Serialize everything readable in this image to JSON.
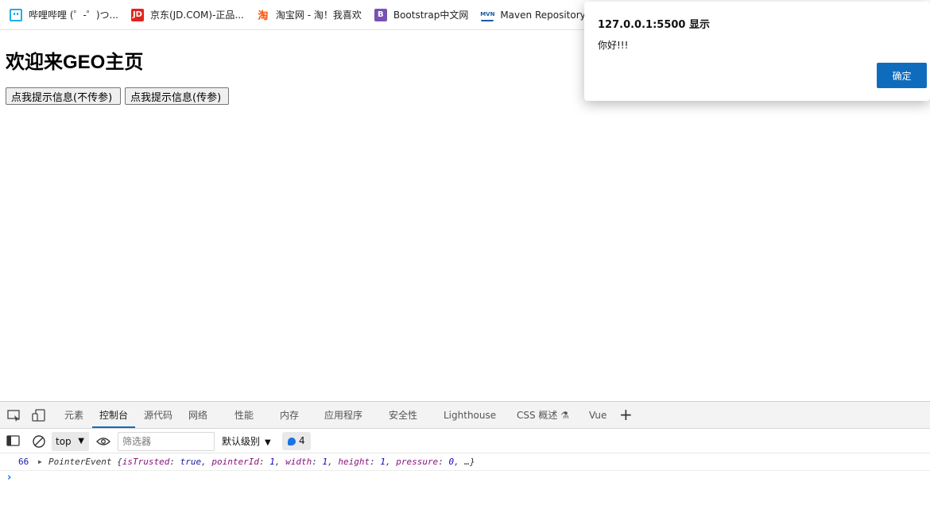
{
  "bookmarks": [
    {
      "icon": "bilibili-icon",
      "label": "哔哩哔哩 (゜-゜)つ..."
    },
    {
      "icon": "jd-icon",
      "icon_text": "JD",
      "label": "京东(JD.COM)-正品..."
    },
    {
      "icon": "taobao-icon",
      "icon_text": "淘",
      "label": "淘宝网 - 淘！我喜欢"
    },
    {
      "icon": "bootstrap-icon",
      "icon_text": "B",
      "label": "Bootstrap中文网"
    },
    {
      "icon": "maven-icon",
      "icon_text": "MVN",
      "label": "Maven Repository:..."
    }
  ],
  "page": {
    "heading": "欢迎来GEO主页",
    "button_no_param": "点我提示信息(不传参)",
    "button_with_param": "点我提示信息(传参)"
  },
  "alert": {
    "title": "127.0.0.1:5500 显示",
    "message": "你好!!!",
    "ok_label": "确定",
    "ok_color": "#0f6cbd"
  },
  "devtools": {
    "tabs": [
      "元素",
      "控制台",
      "源代码",
      "网络",
      "性能",
      "内存",
      "应用程序",
      "安全性",
      "Lighthouse",
      "CSS 概述",
      "Vue"
    ],
    "active_tab": "控制台",
    "context": "top",
    "filter_placeholder": "筛选器",
    "log_level": "默认级别",
    "issues_count": "4",
    "console": {
      "line_number": "66",
      "type": "PointerEvent",
      "props": [
        {
          "key": "isTrusted",
          "value": "true"
        },
        {
          "key": "pointerId",
          "value": "1"
        },
        {
          "key": "width",
          "value": "1"
        },
        {
          "key": "height",
          "value": "1"
        },
        {
          "key": "pressure",
          "value": "0"
        }
      ],
      "ellipsis": "…"
    },
    "prompt": "›"
  }
}
